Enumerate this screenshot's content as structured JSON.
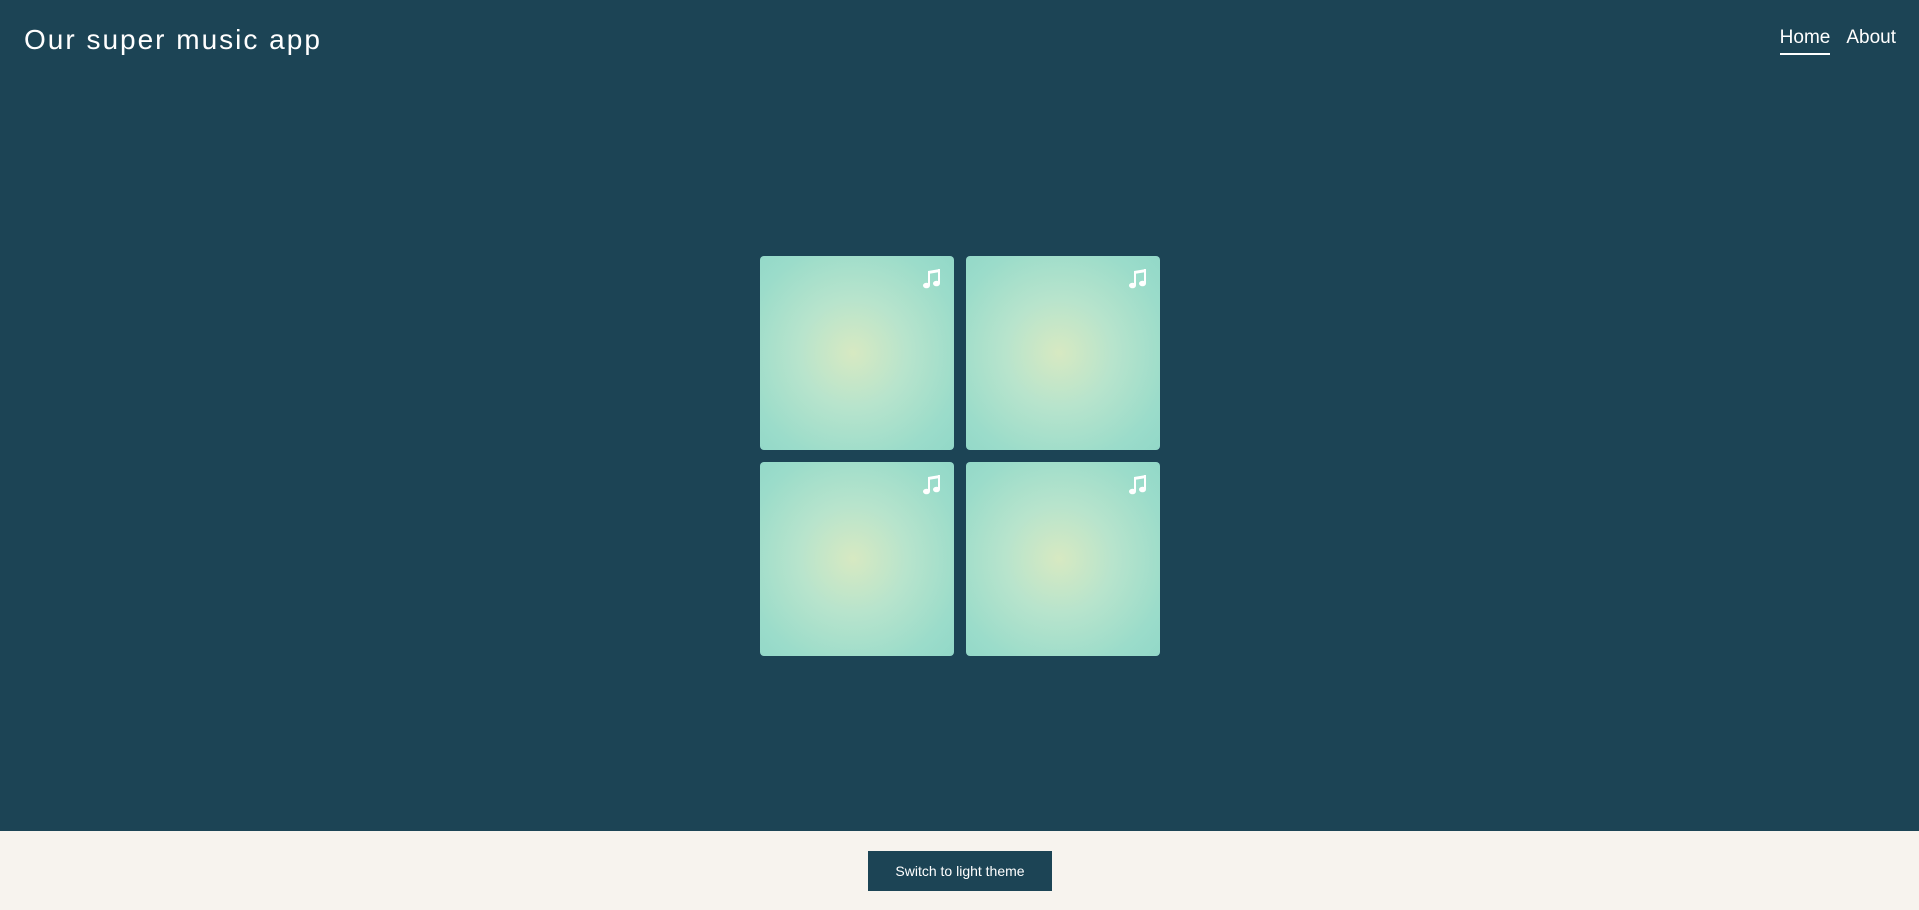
{
  "app": {
    "title": "Our super music app"
  },
  "nav": {
    "items": [
      {
        "label": "Home",
        "active": true
      },
      {
        "label": "About",
        "active": false
      }
    ]
  },
  "tiles": [
    {
      "icon": "music-note-icon"
    },
    {
      "icon": "music-note-icon"
    },
    {
      "icon": "music-note-icon"
    },
    {
      "icon": "music-note-icon"
    }
  ],
  "footer": {
    "theme_button_label": "Switch to light theme"
  },
  "colors": {
    "background": "#1c4455",
    "tile_gradient_center": "#d7e9c2",
    "tile_gradient_edge": "#92d8c8",
    "footer_background": "#f7f3ee",
    "text": "#ffffff"
  }
}
